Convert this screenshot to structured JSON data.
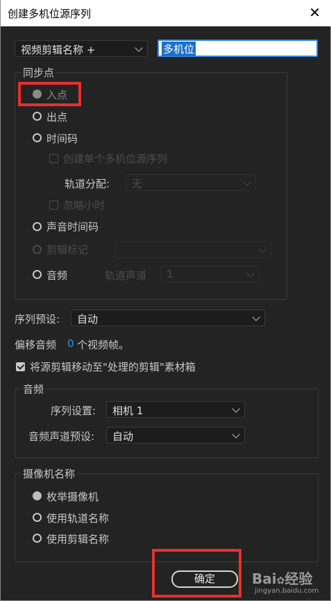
{
  "window": {
    "title": "创建多机位源序列",
    "close_glyph": "✕"
  },
  "name_source": {
    "dropdown_value": "视频剪辑名称 +",
    "name_input_value": "多机位"
  },
  "sync_point": {
    "label": "同步点",
    "in_point": "入点",
    "out_point": "出点",
    "timecode": "时间码",
    "create_single": "创建单个多机位源序列",
    "track_assign_label": "轨道分配:",
    "track_assign_value": "无",
    "ignore_hours": "忽略小时",
    "audio_timecode": "声音时间码",
    "clip_marker": "剪辑标记",
    "audio": "音频",
    "track_channel_label": "轨道声道",
    "track_channel_value": "1"
  },
  "sequence_preset": {
    "label": "序列预设:",
    "value": "自动"
  },
  "offset_audio": {
    "prefix": "偏移音频",
    "value": "0",
    "suffix": "个视频帧。"
  },
  "move_clips": {
    "label": "将源剪辑移动至\"处理的剪辑\"素材箱",
    "checked": true
  },
  "audio_group": {
    "label": "音频",
    "sequence_settings_label": "序列设置:",
    "sequence_settings_value": "相机 1",
    "channel_preset_label": "音频声道预设:",
    "channel_preset_value": "自动"
  },
  "camera_names": {
    "label": "摄像机名称",
    "enumerate": "枚举摄像机",
    "use_track_names": "使用轨道名称",
    "use_clip_names": "使用剪辑名称"
  },
  "ok_button": "确定",
  "watermark": {
    "brand": "Bai",
    "brand2": "经验",
    "url": "jingyan.baidu.com"
  },
  "colors": {
    "accent_blue": "#3a8ee6",
    "highlight_red": "#e8302c",
    "background": "#232323"
  }
}
